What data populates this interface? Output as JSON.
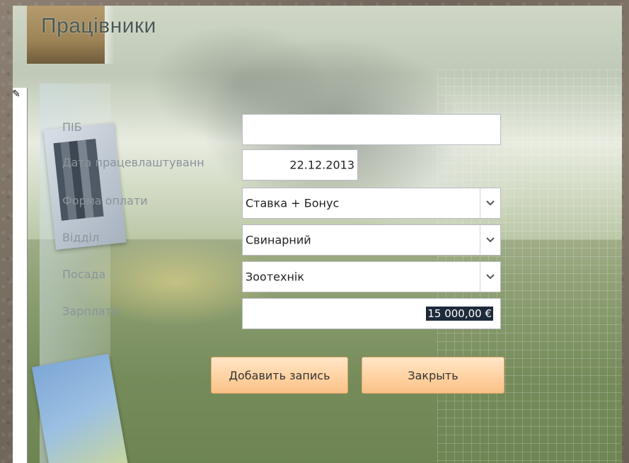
{
  "form": {
    "title": "Працівники",
    "pencil_icon": "pencil-icon",
    "fields": {
      "pib": {
        "label": "ПІБ",
        "value": ""
      },
      "hire_date": {
        "label": "Дата працевлаштуванн",
        "value": "22.12.2013"
      },
      "payment_form": {
        "label": "Форма оплати",
        "value": "Ставка + Бонус"
      },
      "department": {
        "label": "Відділ",
        "value": "Свинарний"
      },
      "position": {
        "label": "Посада",
        "value": "Зоотехнік"
      },
      "salary": {
        "label": "Зарплата",
        "value": "15 000,00 €"
      }
    },
    "buttons": {
      "add": "Добавить запись",
      "close": "Закрыть"
    },
    "dropdown_icon": "chevron-down-icon"
  }
}
